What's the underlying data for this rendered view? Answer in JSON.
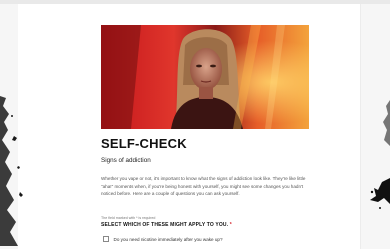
{
  "colors": {
    "accent_red": "#d4222a",
    "text_dark": "#111111",
    "text_body": "#555555"
  },
  "hero": {
    "image": "portrait-woman-red-orange-grunge"
  },
  "heading": {
    "title": "SELF-CHECK",
    "subtitle": "Signs of addiction"
  },
  "intro": {
    "text": "Whether you vape or not, it's important to know what the signs of addiction look like. They're like little \"aha!\" moments when, if you're being honest with yourself, you might see some changes you hadn't noticed before. Here are a couple of questions you can ask yourself."
  },
  "form": {
    "required_note": "The field marked with * is required",
    "required_star": "*",
    "question": "SELECT WHICH OF THESE MIGHT APPLY TO YOU.",
    "options": [
      {
        "label": "Do you need nicotine immediately after you wake up?",
        "checked": false
      }
    ]
  }
}
